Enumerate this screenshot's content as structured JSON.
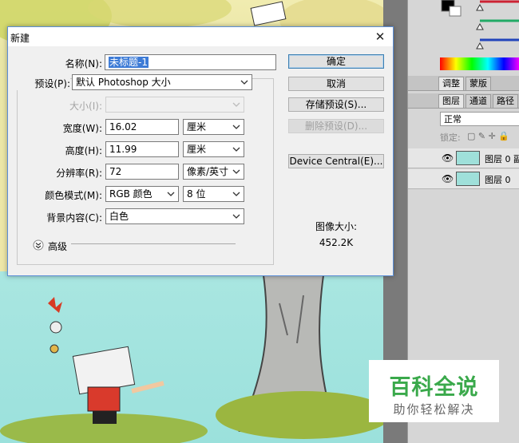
{
  "dialog": {
    "title": "新建",
    "name_label": "名称(N):",
    "name_value": "未标题-1",
    "preset_label": "预设(P):",
    "preset_value": "默认 Photoshop 大小",
    "size_label": "大小(I):",
    "size_value": "",
    "width_label": "宽度(W):",
    "width_value": "16.02",
    "width_unit": "厘米",
    "height_label": "高度(H):",
    "height_value": "11.99",
    "height_unit": "厘米",
    "resolution_label": "分辨率(R):",
    "resolution_value": "72",
    "resolution_unit": "像素/英寸",
    "color_mode_label": "颜色模式(M):",
    "color_mode_value": "RGB 颜色",
    "bit_depth_value": "8 位",
    "background_label": "背景内容(C):",
    "background_value": "白色",
    "advanced_label": "高级",
    "buttons": {
      "ok": "确定",
      "cancel": "取消",
      "save_preset": "存储预设(S)...",
      "delete_preset": "删除预设(D)...",
      "device_central": "Device Central(E)..."
    },
    "image_size_label": "图像大小:",
    "image_size_value": "452.2K"
  },
  "right_panel": {
    "tabs_top": [
      "调整",
      "蒙版"
    ],
    "tabs_layers": [
      "图层",
      "通道",
      "路径"
    ],
    "blend_mode": "正常",
    "lock_label": "锁定:",
    "layers": [
      "图层 0 副",
      "图层 0"
    ],
    "swatch_colors": [
      "#000000",
      "#ffffff"
    ]
  },
  "watermark": {
    "title": "百科全说",
    "subtitle": "助你轻松解决"
  }
}
